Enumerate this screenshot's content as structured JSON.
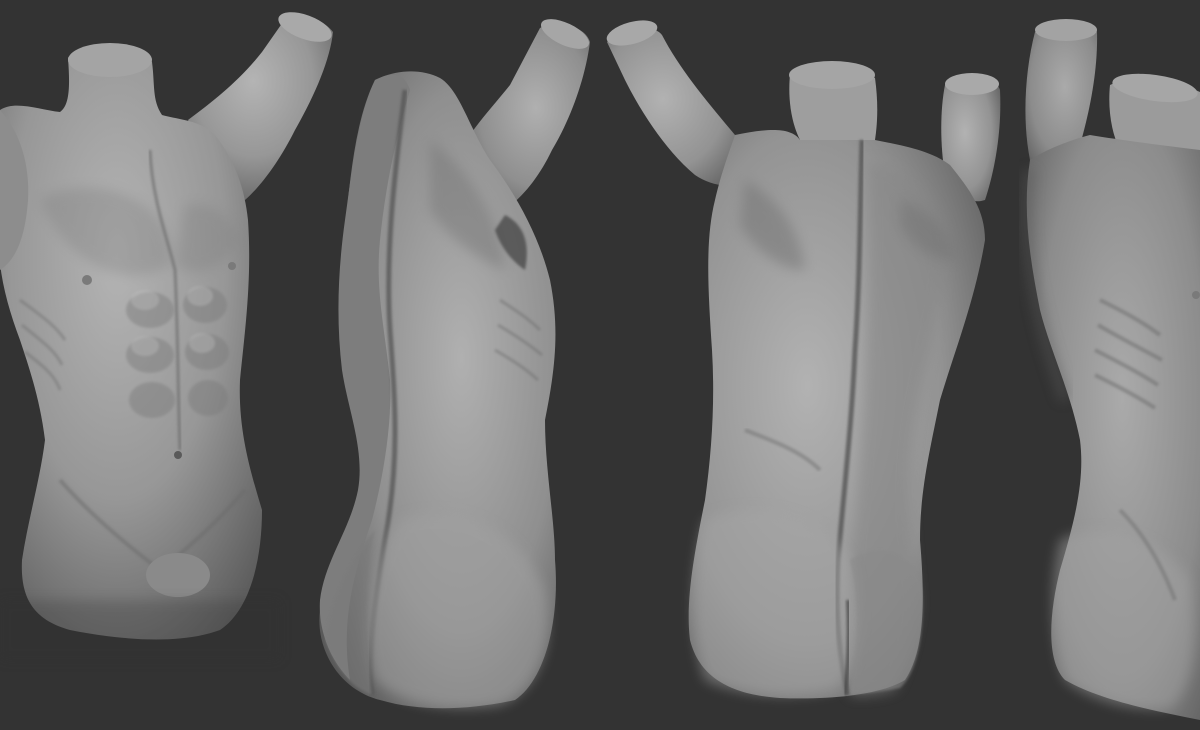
{
  "scene": {
    "background_color": "#333333",
    "material_color": "#9a9a9a",
    "views": [
      {
        "name": "front-three-quarter-view"
      },
      {
        "name": "left-back-three-quarter-view"
      },
      {
        "name": "right-back-three-quarter-view"
      },
      {
        "name": "side-view-cropped"
      }
    ]
  }
}
